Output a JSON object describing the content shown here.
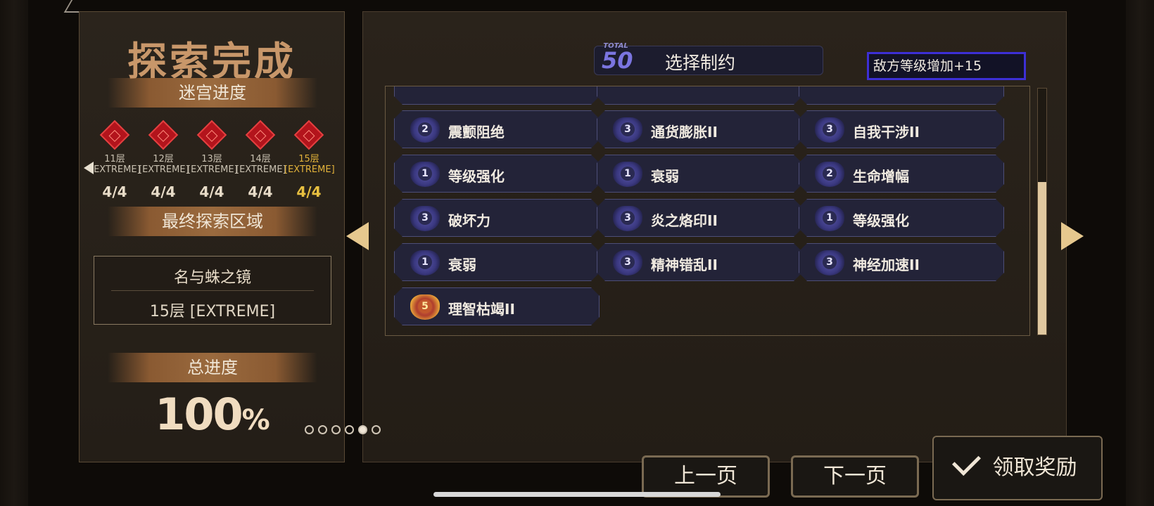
{
  "left": {
    "title": "探索完成",
    "maze_progress_label": "迷宫进度",
    "floors": [
      {
        "label": "11层",
        "mode": "[EXTREME]",
        "count": "4/4",
        "current": false
      },
      {
        "label": "12层",
        "mode": "[EXTREME]",
        "count": "4/4",
        "current": false
      },
      {
        "label": "13层",
        "mode": "[EXTREME]",
        "count": "4/4",
        "current": false
      },
      {
        "label": "14层",
        "mode": "[EXTREME]",
        "count": "4/4",
        "current": false
      },
      {
        "label": "15层",
        "mode": "[EXTREME]",
        "count": "4/4",
        "current": true
      }
    ],
    "final_area_label": "最终探索区域",
    "area_name": "名与蛛之镜",
    "area_floor": "15层 [EXTREME]",
    "total_progress_label": "总进度",
    "total_progress_value": "100",
    "total_progress_unit": "%"
  },
  "right": {
    "total_label": "TOTAL",
    "total_value": "50",
    "header_title": "选择制约",
    "info_text": "敌方等级增加+15",
    "cards": [
      {
        "level": "2",
        "label": "震颤阻绝",
        "gold": false
      },
      {
        "level": "3",
        "label": "通货膨胀II",
        "gold": false
      },
      {
        "level": "3",
        "label": "自我干涉II",
        "gold": false
      },
      {
        "level": "1",
        "label": "等级强化",
        "gold": false
      },
      {
        "level": "1",
        "label": "衰弱",
        "gold": false
      },
      {
        "level": "2",
        "label": "生命增幅",
        "gold": false
      },
      {
        "level": "3",
        "label": "破坏力",
        "gold": false
      },
      {
        "level": "3",
        "label": "炎之烙印II",
        "gold": false
      },
      {
        "level": "1",
        "label": "等级强化",
        "gold": false
      },
      {
        "level": "1",
        "label": "衰弱",
        "gold": false
      },
      {
        "level": "3",
        "label": "精神错乱II",
        "gold": false
      },
      {
        "level": "3",
        "label": "神经加速II",
        "gold": false
      },
      {
        "level": "5",
        "label": "理智枯竭II",
        "gold": true
      }
    ],
    "page_count": 6,
    "current_page": 5,
    "scroll_position": 0.38
  },
  "buttons": {
    "prev": "上一页",
    "next": "下一页",
    "claim": "领取奖励"
  },
  "colors": {
    "accent_gold": "#e8c040",
    "title_brown": "#c8976a",
    "highlight_blue": "#3d2fd6",
    "card_bg": "#232338"
  }
}
